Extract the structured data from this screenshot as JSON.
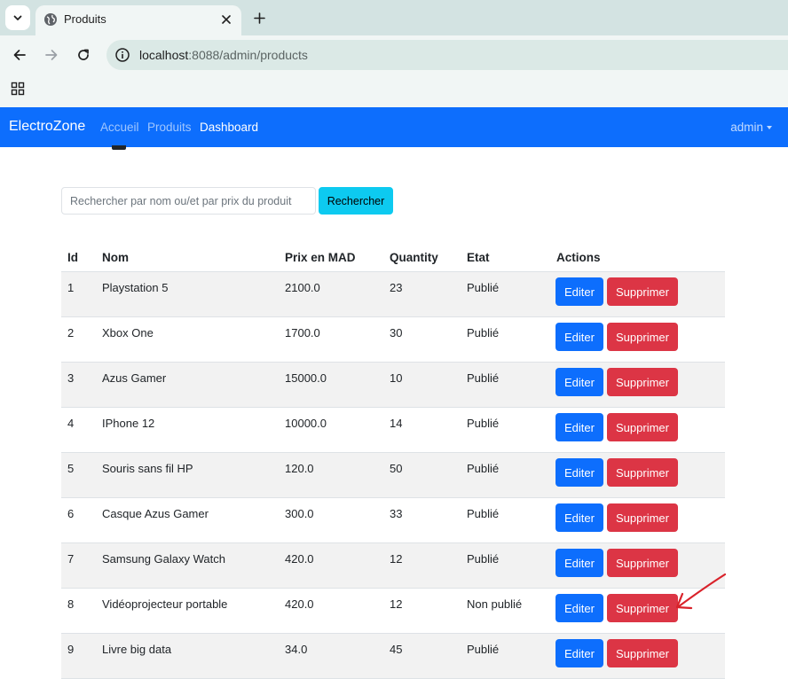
{
  "browser": {
    "tab_title": "Produits",
    "url_host": "localhost",
    "url_rest": ":8088/admin/products"
  },
  "navbar": {
    "brand": "ElectroZone",
    "links": [
      {
        "label": "Accueil",
        "active": false
      },
      {
        "label": "Produits",
        "active": false
      },
      {
        "label": "Dashboard",
        "active": true
      }
    ],
    "user": "admin"
  },
  "search": {
    "placeholder": "Rechercher par nom ou/et par prix du produit",
    "value": "",
    "button_label": "Rechercher"
  },
  "table": {
    "headers": [
      "Id",
      "Nom",
      "Prix en MAD",
      "Quantity",
      "Etat",
      "Actions"
    ],
    "edit_label": "Editer",
    "delete_label": "Supprimer",
    "rows": [
      {
        "id": "1",
        "nom": "Playstation 5",
        "prix": "2100.0",
        "quantity": "23",
        "etat": "Publié"
      },
      {
        "id": "2",
        "nom": "Xbox One",
        "prix": "1700.0",
        "quantity": "30",
        "etat": "Publié"
      },
      {
        "id": "3",
        "nom": "Azus Gamer",
        "prix": "15000.0",
        "quantity": "10",
        "etat": "Publié"
      },
      {
        "id": "4",
        "nom": "IPhone 12",
        "prix": "10000.0",
        "quantity": "14",
        "etat": "Publié"
      },
      {
        "id": "5",
        "nom": "Souris sans fil HP",
        "prix": "120.0",
        "quantity": "50",
        "etat": "Publié"
      },
      {
        "id": "6",
        "nom": "Casque Azus Gamer",
        "prix": "300.0",
        "quantity": "33",
        "etat": "Publié"
      },
      {
        "id": "7",
        "nom": "Samsung Galaxy Watch",
        "prix": "420.0",
        "quantity": "12",
        "etat": "Publié"
      },
      {
        "id": "8",
        "nom": "Vidéoprojecteur portable",
        "prix": "420.0",
        "quantity": "12",
        "etat": "Non publié"
      },
      {
        "id": "9",
        "nom": "Livre big data",
        "prix": "34.0",
        "quantity": "45",
        "etat": "Publié"
      }
    ]
  },
  "colors": {
    "navbar": "#0d6efd",
    "search_button": "#0dcaf0",
    "edit_button": "#0d6efd",
    "delete_button": "#dc3545",
    "annotation_arrow": "#d9222a"
  },
  "icons": [
    "tab-search-icon",
    "globe-favicon-icon",
    "close-icon",
    "plus-icon",
    "back-icon",
    "forward-icon",
    "reload-icon",
    "site-info-icon",
    "apps-grid-icon",
    "red-arrow-annotation"
  ]
}
